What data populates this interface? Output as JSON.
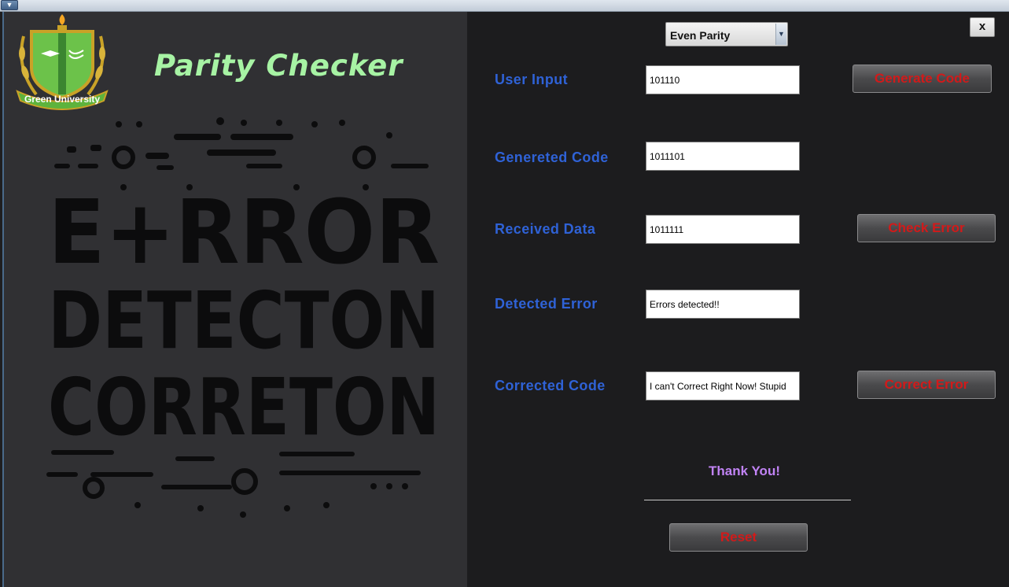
{
  "app": {
    "title": "Parity Checker",
    "logo_text": "Green University",
    "art_lines": [
      "E+RROR",
      "DETECTON",
      "CORRETON"
    ]
  },
  "parity_select": {
    "selected": "Even Parity"
  },
  "close_label": "x",
  "fields": {
    "user_input": {
      "label": "User Input",
      "value": "101110"
    },
    "generated_code": {
      "label": "Genereted Code",
      "value": "1011101"
    },
    "received_data": {
      "label": "Received Data",
      "value": "1011111"
    },
    "detected_error": {
      "label": "Detected Error",
      "value": "Errors detected!!"
    },
    "corrected_code": {
      "label": "Corrected Code",
      "value": "I can't Correct Right Now! Stupid"
    }
  },
  "buttons": {
    "generate_code": "Generate Code",
    "check_error": "Check Error",
    "correct_error": "Correct Error",
    "reset": "Reset"
  },
  "thanks_text": "Thank You!",
  "colors": {
    "label_blue": "#2f62d6",
    "button_red": "#d21a1a",
    "title_green": "#a7f3a4",
    "thanks_purple": "#c183f5"
  }
}
